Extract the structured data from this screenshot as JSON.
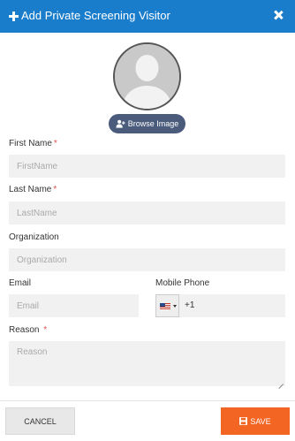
{
  "header": {
    "title": "Add Private Screening Visitor",
    "icon": "plus-icon",
    "close_icon": "close-icon"
  },
  "avatar": {
    "icon": "user-silhouette-icon"
  },
  "browse_button": {
    "label": "Browse Image",
    "icon": "user-plus-icon"
  },
  "fields": {
    "first_name": {
      "label": "First Name",
      "required_mark": "*",
      "placeholder": "FirstName"
    },
    "last_name": {
      "label": "Last Name",
      "required_mark": "*",
      "placeholder": "LastName"
    },
    "organization": {
      "label": "Organization",
      "placeholder": "Organization"
    },
    "email": {
      "label": "Email",
      "placeholder": "Email"
    },
    "mobile_phone": {
      "label": "Mobile Phone",
      "country_flag": "us-flag-icon",
      "dial_code": "+1"
    },
    "reason": {
      "label": "Reason",
      "required_mark": "*",
      "placeholder": "Reason"
    }
  },
  "footer": {
    "cancel_label": "CANCEL",
    "save_label": "SAVE",
    "save_icon": "floppy-disk-icon"
  },
  "colors": {
    "header": "#1a7dcb",
    "browse": "#4a5b7c",
    "save": "#f26522",
    "required": "#d9534f"
  }
}
